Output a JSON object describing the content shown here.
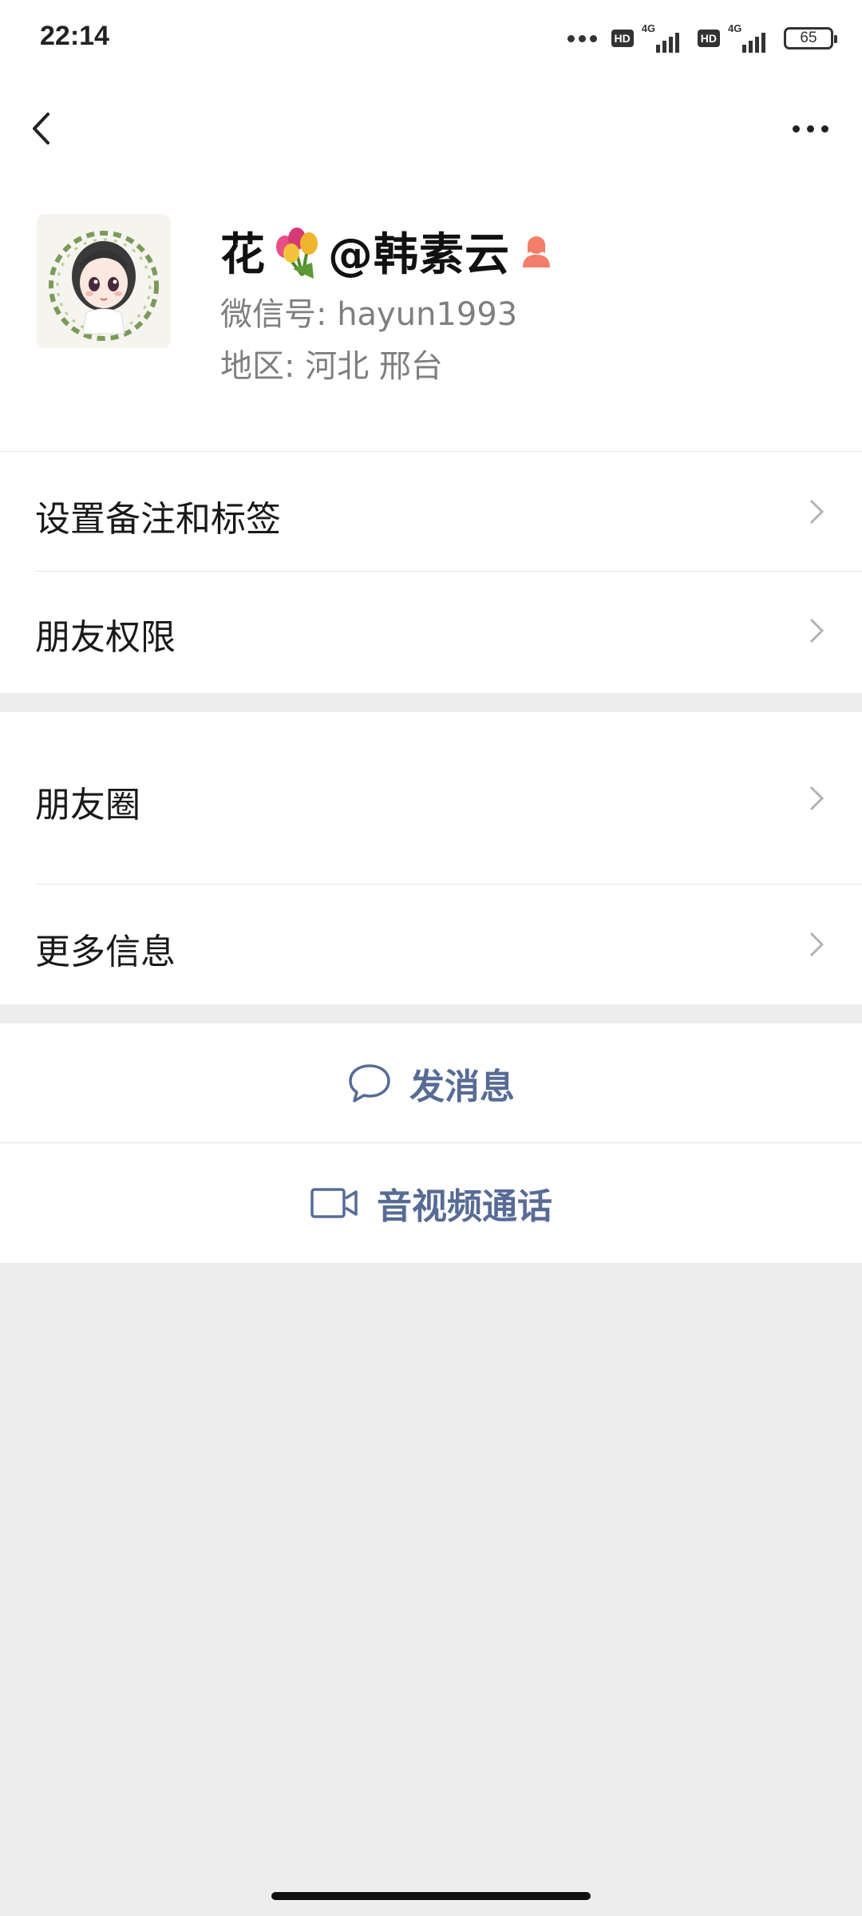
{
  "status_bar": {
    "time": "22:14",
    "hd_label": "HD",
    "network_label": "4G",
    "battery": "65"
  },
  "header": {
    "back_icon": "chevron-left-icon",
    "more_icon": "ellipsis-icon"
  },
  "profile": {
    "name_prefix": "花",
    "name_suffix": "@韩素云",
    "wechat_id": "微信号:  hayun1993",
    "region": "地区:  河北  邢台",
    "gender_color": "#f37e6a"
  },
  "menu": {
    "remark_tags": "设置备注和标签",
    "friend_permissions": "朋友权限",
    "moments": "朋友圈",
    "more_info": "更多信息"
  },
  "actions": {
    "send_message": "发消息",
    "video_call": "音视频通话"
  },
  "colors": {
    "link": "#576b95",
    "background": "#ededed"
  }
}
